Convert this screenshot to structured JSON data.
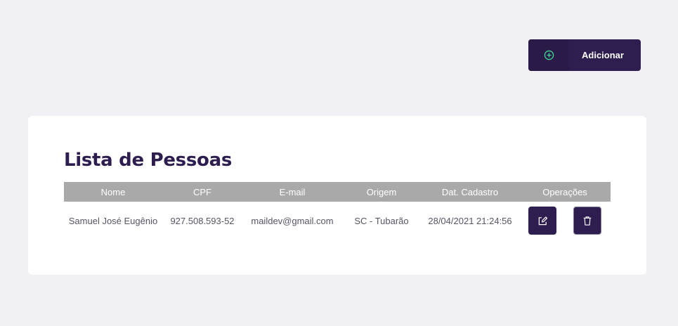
{
  "toolbar": {
    "add_label": "Adicionar",
    "add_icon": "plus-circle-icon"
  },
  "list": {
    "title": "Lista de Pessoas",
    "columns": [
      "Nome",
      "CPF",
      "E-mail",
      "Origem",
      "Dat. Cadastro",
      "Operações"
    ],
    "rows": [
      {
        "nome": "Samuel José Eugênio",
        "cpf": "927.508.593-52",
        "email": "maildev@gmail.com",
        "origem": "SC - Tubarão",
        "cadastro": "28/04/2021 21:24:56",
        "edit_icon": "edit-icon",
        "delete_icon": "trash-icon"
      }
    ]
  },
  "colors": {
    "primary": "#2e1d4f",
    "accent_icon": "#3ddc97",
    "header_bg": "#a9a9a9",
    "page_bg": "#f0f0f5"
  }
}
